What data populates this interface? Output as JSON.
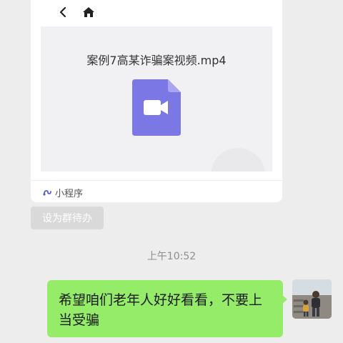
{
  "card": {
    "file_name": "案例7高某诈骗案视频.mp4",
    "file_icon": "video-file-icon",
    "source_label": "小程序",
    "source_icon": "mini-program-icon"
  },
  "nav": {
    "back_icon": "chevron-left-icon",
    "home_icon": "home-icon"
  },
  "todo_button": {
    "label": "设为群待办"
  },
  "timestamp": "上午10:52",
  "message": {
    "text": "希望咱们老年人好好看看，不要上当受骗",
    "bubble_color": "#95ec69"
  },
  "colors": {
    "background": "#ededed",
    "file_icon": "#7b78e6"
  }
}
